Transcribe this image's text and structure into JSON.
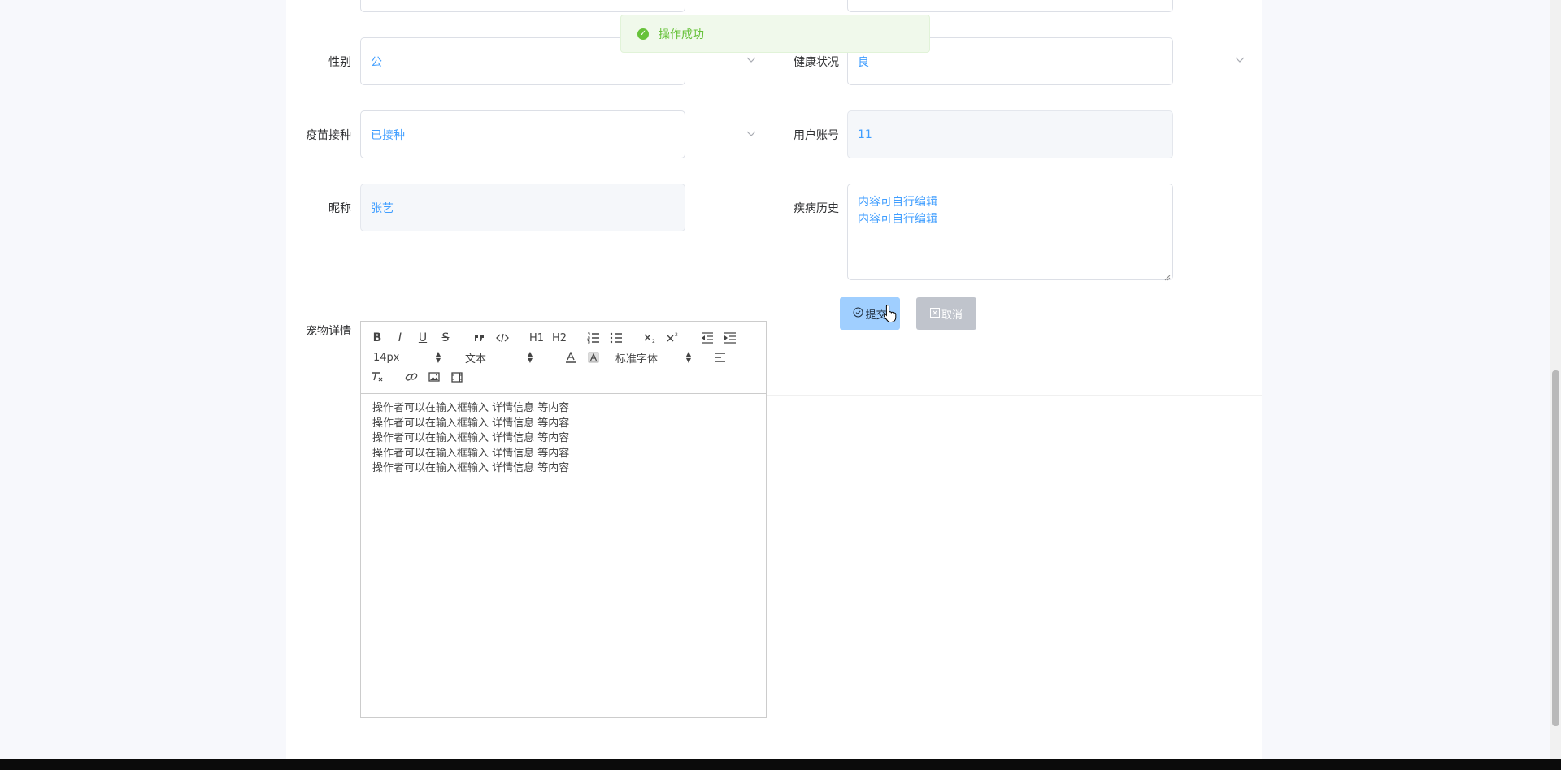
{
  "toast": {
    "message": "操作成功",
    "icon": "check-circle-icon",
    "color": "#67c23a"
  },
  "form": {
    "gender": {
      "label": "性别",
      "value": "公"
    },
    "health": {
      "label": "健康状况",
      "value": "良"
    },
    "vaccine": {
      "label": "疫苗接种",
      "value": "已接种"
    },
    "account": {
      "label": "用户账号",
      "value": "11"
    },
    "nickname": {
      "label": "昵称",
      "value": "张艺"
    },
    "history": {
      "label": "疾病历史",
      "lines": [
        "内容可自行编辑",
        "内容可自行编辑"
      ]
    },
    "details": {
      "label": "宠物详情"
    }
  },
  "buttons": {
    "submit": "提交",
    "cancel": "取消"
  },
  "editor": {
    "toolbar": {
      "size": "14px",
      "header": "文本",
      "font": "标准字体",
      "bold": "B",
      "italic": "I",
      "underline": "U",
      "strike": "S",
      "h1": "H1",
      "h2": "H2"
    },
    "content": [
      "操作者可以在输入框输入 详情信息 等内容",
      "操作者可以在输入框输入 详情信息 等内容",
      "操作者可以在输入框输入 详情信息 等内容",
      "操作者可以在输入框输入 详情信息 等内容",
      "操作者可以在输入框输入 详情信息 等内容"
    ]
  },
  "colors": {
    "accent": "#409eff",
    "submit_bg": "#a0cfff",
    "cancel_bg": "#c0c4cc"
  }
}
